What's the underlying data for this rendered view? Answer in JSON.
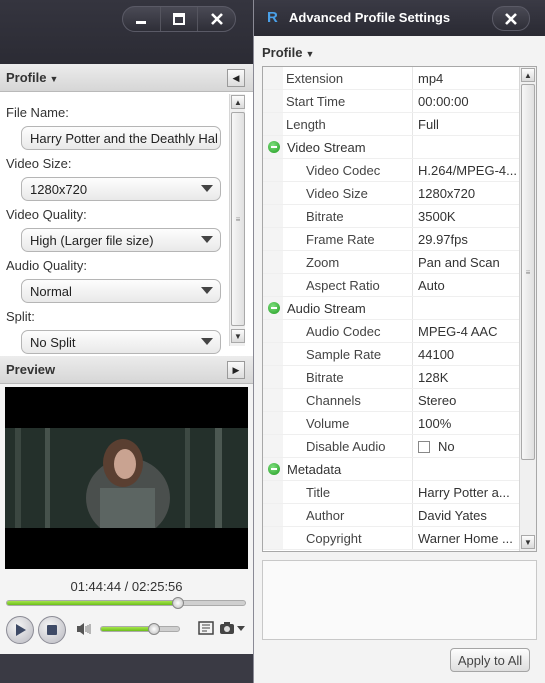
{
  "left_window": {
    "profile_panel": {
      "title": "Profile",
      "file_name_label": "File Name:",
      "file_name_value": "Harry Potter and the Deathly Hal",
      "video_size_label": "Video Size:",
      "video_size_value": "1280x720",
      "video_quality_label": "Video Quality:",
      "video_quality_value": "High (Larger file size)",
      "audio_quality_label": "Audio Quality:",
      "audio_quality_value": "Normal",
      "split_label": "Split:",
      "split_value": "No Split"
    },
    "preview_panel": {
      "title": "Preview",
      "time_display": "01:44:44 / 02:25:56",
      "seek_progress": 0.72,
      "volume_level": 0.68
    }
  },
  "right_window": {
    "title": "Advanced Profile Settings",
    "logo_glyph": "R",
    "profile_label": "Profile",
    "settings": [
      {
        "type": "item",
        "label": "Extension",
        "value": "mp4",
        "indent": 0
      },
      {
        "type": "item",
        "label": "Start Time",
        "value": "00:00:00",
        "indent": 0
      },
      {
        "type": "item",
        "label": "Length",
        "value": "Full",
        "indent": 0
      },
      {
        "type": "section",
        "label": "Video Stream"
      },
      {
        "type": "item",
        "label": "Video Codec",
        "value": "H.264/MPEG-4...",
        "indent": 1
      },
      {
        "type": "item",
        "label": "Video Size",
        "value": "1280x720",
        "indent": 1
      },
      {
        "type": "item",
        "label": "Bitrate",
        "value": "3500K",
        "indent": 1
      },
      {
        "type": "item",
        "label": "Frame Rate",
        "value": "29.97fps",
        "indent": 1
      },
      {
        "type": "item",
        "label": "Zoom",
        "value": "Pan and Scan",
        "indent": 1
      },
      {
        "type": "item",
        "label": "Aspect Ratio",
        "value": "Auto",
        "indent": 1
      },
      {
        "type": "section",
        "label": "Audio Stream"
      },
      {
        "type": "item",
        "label": "Audio Codec",
        "value": "MPEG-4 AAC",
        "indent": 1
      },
      {
        "type": "item",
        "label": "Sample Rate",
        "value": "44100",
        "indent": 1
      },
      {
        "type": "item",
        "label": "Bitrate",
        "value": "128K",
        "indent": 1
      },
      {
        "type": "item",
        "label": "Channels",
        "value": "Stereo",
        "indent": 1
      },
      {
        "type": "item",
        "label": "Volume",
        "value": "100%",
        "indent": 1
      },
      {
        "type": "check",
        "label": "Disable Audio",
        "value": "No",
        "indent": 1
      },
      {
        "type": "section",
        "label": "Metadata"
      },
      {
        "type": "item",
        "label": "Title",
        "value": "Harry Potter a...",
        "indent": 1
      },
      {
        "type": "item",
        "label": "Author",
        "value": "David Yates",
        "indent": 1
      },
      {
        "type": "item",
        "label": "Copyright",
        "value": "Warner Home ...",
        "indent": 1
      }
    ],
    "apply_button": "Apply to All"
  },
  "colors": {
    "title_bar": "#2f2f39",
    "progress_green": "#7ccb24",
    "section_icon_green": "#2aa52a",
    "logo_blue": "#4aa0e8"
  }
}
